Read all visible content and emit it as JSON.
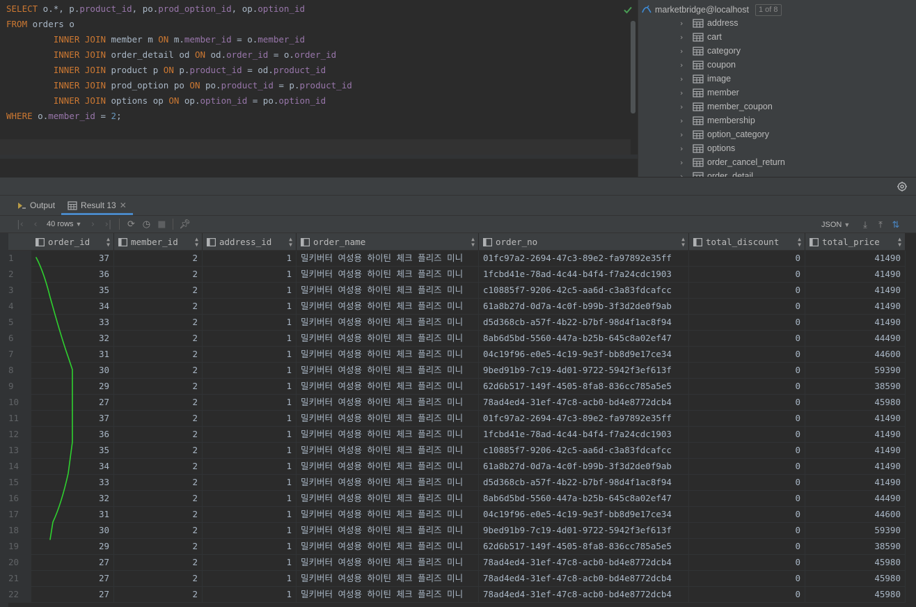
{
  "editor": {
    "lines": [
      [
        {
          "t": "SELECT",
          "k": "kw"
        },
        {
          "t": " o.*, p."
        },
        {
          "t": "product_id",
          "k": "fld"
        },
        {
          "t": ", po."
        },
        {
          "t": "prod_option_id",
          "k": "fld"
        },
        {
          "t": ", op."
        },
        {
          "t": "option_id",
          "k": "fld"
        }
      ],
      [
        {
          "t": "FROM",
          "k": "kw"
        },
        {
          "t": " orders o"
        }
      ],
      [
        {
          "t": "         "
        },
        {
          "t": "INNER JOIN",
          "k": "kw"
        },
        {
          "t": " member m "
        },
        {
          "t": "ON",
          "k": "kw"
        },
        {
          "t": " m."
        },
        {
          "t": "member_id",
          "k": "fld"
        },
        {
          "t": " = o."
        },
        {
          "t": "member_id",
          "k": "fld"
        }
      ],
      [
        {
          "t": "         "
        },
        {
          "t": "INNER JOIN",
          "k": "kw"
        },
        {
          "t": " order_detail od "
        },
        {
          "t": "ON",
          "k": "kw"
        },
        {
          "t": " od."
        },
        {
          "t": "order_id",
          "k": "fld"
        },
        {
          "t": " = o."
        },
        {
          "t": "order_id",
          "k": "fld"
        }
      ],
      [
        {
          "t": "         "
        },
        {
          "t": "INNER JOIN",
          "k": "kw"
        },
        {
          "t": " product p "
        },
        {
          "t": "ON",
          "k": "kw"
        },
        {
          "t": " p."
        },
        {
          "t": "product_id",
          "k": "fld"
        },
        {
          "t": " = od."
        },
        {
          "t": "product_id",
          "k": "fld"
        }
      ],
      [
        {
          "t": "         "
        },
        {
          "t": "INNER JOIN",
          "k": "kw"
        },
        {
          "t": " prod_option po "
        },
        {
          "t": "ON",
          "k": "kw"
        },
        {
          "t": " po."
        },
        {
          "t": "product_id",
          "k": "fld"
        },
        {
          "t": " = p."
        },
        {
          "t": "product_id",
          "k": "fld"
        }
      ],
      [
        {
          "t": "         "
        },
        {
          "t": "INNER JOIN",
          "k": "kw"
        },
        {
          "t": " options op "
        },
        {
          "t": "ON",
          "k": "kw"
        },
        {
          "t": " op."
        },
        {
          "t": "option_id",
          "k": "fld"
        },
        {
          "t": " = po."
        },
        {
          "t": "option_id",
          "k": "fld"
        }
      ],
      [
        {
          "t": "WHERE",
          "k": "kw"
        },
        {
          "t": " o."
        },
        {
          "t": "member_id",
          "k": "fld"
        },
        {
          "t": " = "
        },
        {
          "t": "2",
          "k": "num"
        },
        {
          "t": ";"
        }
      ],
      [],
      []
    ]
  },
  "db_tree": {
    "root_label": "marketbridge@localhost",
    "badge": "1 of 8",
    "tables": [
      "address",
      "cart",
      "category",
      "coupon",
      "image",
      "member",
      "member_coupon",
      "membership",
      "option_category",
      "options",
      "order_cancel_return",
      "order_detail"
    ]
  },
  "results": {
    "tabs": [
      {
        "label": "Output",
        "icon": "output-icon"
      },
      {
        "label": "Result 13",
        "icon": "table-icon"
      }
    ],
    "rows_selector": "40 rows",
    "format_selector": "JSON",
    "columns": [
      "order_id",
      "member_id",
      "address_id",
      "order_name",
      "order_no",
      "total_discount",
      "total_price"
    ],
    "rows": [
      [
        "1",
        "37",
        "2",
        "1",
        "밀키버터 여성용 하이틴 체크 플리즈 미니",
        "01fc97a2-2694-47c3-89e2-fa97892e35ff",
        "0",
        "41490"
      ],
      [
        "2",
        "36",
        "2",
        "1",
        "밀키버터 여성용 하이틴 체크 플리즈 미니",
        "1fcbd41e-78ad-4c44-b4f4-f7a24cdc1903",
        "0",
        "41490"
      ],
      [
        "3",
        "35",
        "2",
        "1",
        "밀키버터 여성용 하이틴 체크 플리즈 미니",
        "c10885f7-9206-42c5-aa6d-c3a83fdcafcc",
        "0",
        "41490"
      ],
      [
        "4",
        "34",
        "2",
        "1",
        "밀키버터 여성용 하이틴 체크 플리즈 미니",
        "61a8b27d-0d7a-4c0f-b99b-3f3d2de0f9ab",
        "0",
        "41490"
      ],
      [
        "5",
        "33",
        "2",
        "1",
        "밀키버터 여성용 하이틴 체크 플리즈 미니",
        "d5d368cb-a57f-4b22-b7bf-98d4f1ac8f94",
        "0",
        "41490"
      ],
      [
        "6",
        "32",
        "2",
        "1",
        "밀키버터 여성용 하이틴 체크 플리즈 미니",
        "8ab6d5bd-5560-447a-b25b-645c8a02ef47",
        "0",
        "44490"
      ],
      [
        "7",
        "31",
        "2",
        "1",
        "밀키버터 여성용 하이틴 체크 플리즈 미니",
        "04c19f96-e0e5-4c19-9e3f-bb8d9e17ce34",
        "0",
        "44600"
      ],
      [
        "8",
        "30",
        "2",
        "1",
        "밀키버터 여성용 하이틴 체크 플리즈 미니",
        "9bed91b9-7c19-4d01-9722-5942f3ef613f",
        "0",
        "59390"
      ],
      [
        "9",
        "29",
        "2",
        "1",
        "밀키버터 여성용 하이틴 체크 플리즈 미니",
        "62d6b517-149f-4505-8fa8-836cc785a5e5",
        "0",
        "38590"
      ],
      [
        "10",
        "27",
        "2",
        "1",
        "밀키버터 여성용 하이틴 체크 플리즈 미니",
        "78ad4ed4-31ef-47c8-acb0-bd4e8772dcb4",
        "0",
        "45980"
      ],
      [
        "11",
        "37",
        "2",
        "1",
        "밀키버터 여성용 하이틴 체크 플리즈 미니",
        "01fc97a2-2694-47c3-89e2-fa97892e35ff",
        "0",
        "41490"
      ],
      [
        "12",
        "36",
        "2",
        "1",
        "밀키버터 여성용 하이틴 체크 플리즈 미니",
        "1fcbd41e-78ad-4c44-b4f4-f7a24cdc1903",
        "0",
        "41490"
      ],
      [
        "13",
        "35",
        "2",
        "1",
        "밀키버터 여성용 하이틴 체크 플리즈 미니",
        "c10885f7-9206-42c5-aa6d-c3a83fdcafcc",
        "0",
        "41490"
      ],
      [
        "14",
        "34",
        "2",
        "1",
        "밀키버터 여성용 하이틴 체크 플리즈 미니",
        "61a8b27d-0d7a-4c0f-b99b-3f3d2de0f9ab",
        "0",
        "41490"
      ],
      [
        "15",
        "33",
        "2",
        "1",
        "밀키버터 여성용 하이틴 체크 플리즈 미니",
        "d5d368cb-a57f-4b22-b7bf-98d4f1ac8f94",
        "0",
        "41490"
      ],
      [
        "16",
        "32",
        "2",
        "1",
        "밀키버터 여성용 하이틴 체크 플리즈 미니",
        "8ab6d5bd-5560-447a-b25b-645c8a02ef47",
        "0",
        "44490"
      ],
      [
        "17",
        "31",
        "2",
        "1",
        "밀키버터 여성용 하이틴 체크 플리즈 미니",
        "04c19f96-e0e5-4c19-9e3f-bb8d9e17ce34",
        "0",
        "44600"
      ],
      [
        "18",
        "30",
        "2",
        "1",
        "밀키버터 여성용 하이틴 체크 플리즈 미니",
        "9bed91b9-7c19-4d01-9722-5942f3ef613f",
        "0",
        "59390"
      ],
      [
        "19",
        "29",
        "2",
        "1",
        "밀키버터 여성용 하이틴 체크 플리즈 미니",
        "62d6b517-149f-4505-8fa8-836cc785a5e5",
        "0",
        "38590"
      ],
      [
        "20",
        "27",
        "2",
        "1",
        "밀키버터 여성용 하이틴 체크 플리즈 미니",
        "78ad4ed4-31ef-47c8-acb0-bd4e8772dcb4",
        "0",
        "45980"
      ],
      [
        "21",
        "27",
        "2",
        "1",
        "밀키버터 여성용 하이틴 체크 플리즈 미니",
        "78ad4ed4-31ef-47c8-acb0-bd4e8772dcb4",
        "0",
        "45980"
      ],
      [
        "22",
        "27",
        "2",
        "1",
        "밀키버터 여성용 하이틴 체크 플리즈 미니",
        "78ad4ed4-31ef-47c8-acb0-bd4e8772dcb4",
        "0",
        "45980"
      ]
    ]
  },
  "colors": {
    "keyword": "#cc7832",
    "field": "#9876aa",
    "number": "#6897bb",
    "annotation_stroke": "#2fd12f",
    "selection": "#2f65ca"
  }
}
